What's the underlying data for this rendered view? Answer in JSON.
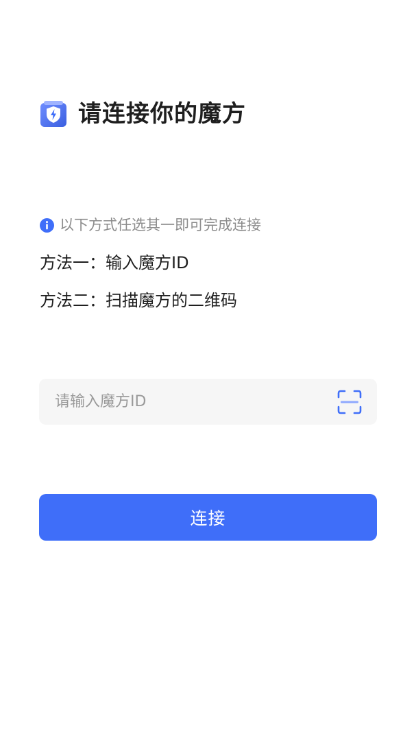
{
  "header": {
    "title": "请连接你的魔方",
    "logo_icon": "shield-lightning-icon"
  },
  "hint": {
    "text": "以下方式任选其一即可完成连接",
    "icon": "info-icon"
  },
  "methods": [
    {
      "label": "方法一：输入魔方ID"
    },
    {
      "label": "方法二：扫描魔方的二维码"
    }
  ],
  "input": {
    "placeholder": "请输入魔方ID",
    "value": "",
    "scan_icon": "scan-icon"
  },
  "connect_button": {
    "label": "连接"
  },
  "colors": {
    "accent": "#3f6ef9",
    "title": "#1e1e1e",
    "hint": "#8c8c8c",
    "input_bg": "#f6f6f6"
  }
}
